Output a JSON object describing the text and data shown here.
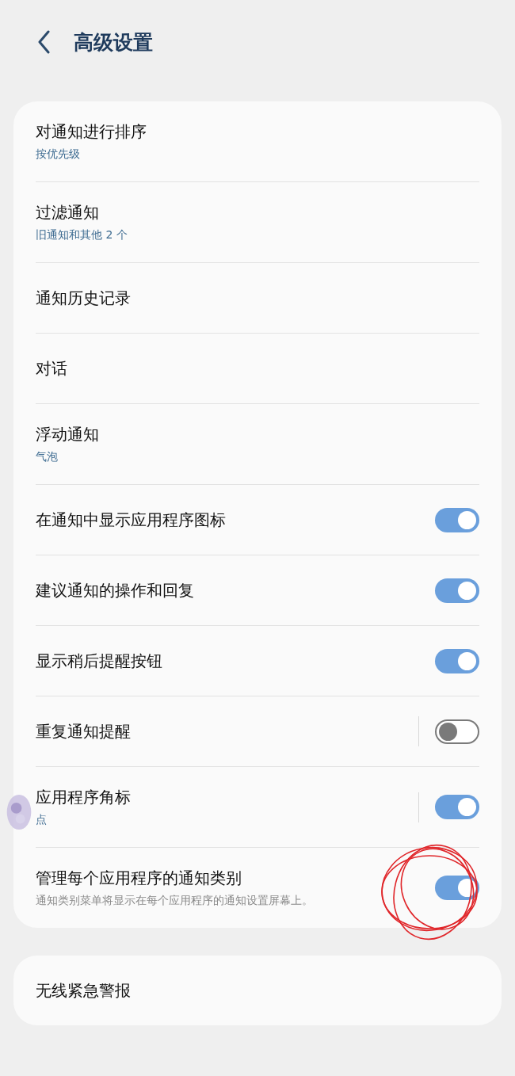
{
  "header": {
    "title": "高级设置"
  },
  "settings": [
    {
      "kind": "link",
      "label": "对通知进行排序",
      "subtitle": "按优先级",
      "subtitle_muted": false
    },
    {
      "kind": "link",
      "label": "过滤通知",
      "subtitle": "旧通知和其他 2 个",
      "subtitle_muted": false
    },
    {
      "kind": "link",
      "label": "通知历史记录"
    },
    {
      "kind": "link",
      "label": "对话"
    },
    {
      "kind": "link",
      "label": "浮动通知",
      "subtitle": "气泡",
      "subtitle_muted": false
    },
    {
      "kind": "toggle",
      "label": "在通知中显示应用程序图标",
      "on": true,
      "split": false
    },
    {
      "kind": "toggle",
      "label": "建议通知的操作和回复",
      "on": true,
      "split": false
    },
    {
      "kind": "toggle",
      "label": "显示稍后提醒按钮",
      "on": true,
      "split": false
    },
    {
      "kind": "toggle",
      "label": "重复通知提醒",
      "on": false,
      "split": true
    },
    {
      "kind": "toggle",
      "label": "应用程序角标",
      "subtitle": "点",
      "subtitle_muted": false,
      "on": true,
      "split": true
    },
    {
      "kind": "toggle",
      "label": "管理每个应用程序的通知类别",
      "subtitle": "通知类别菜单将显示在每个应用程序的通知设置屏幕上。",
      "subtitle_muted": true,
      "on": true,
      "split": false
    }
  ],
  "extra": [
    {
      "kind": "link",
      "label": "无线紧急警报"
    }
  ]
}
